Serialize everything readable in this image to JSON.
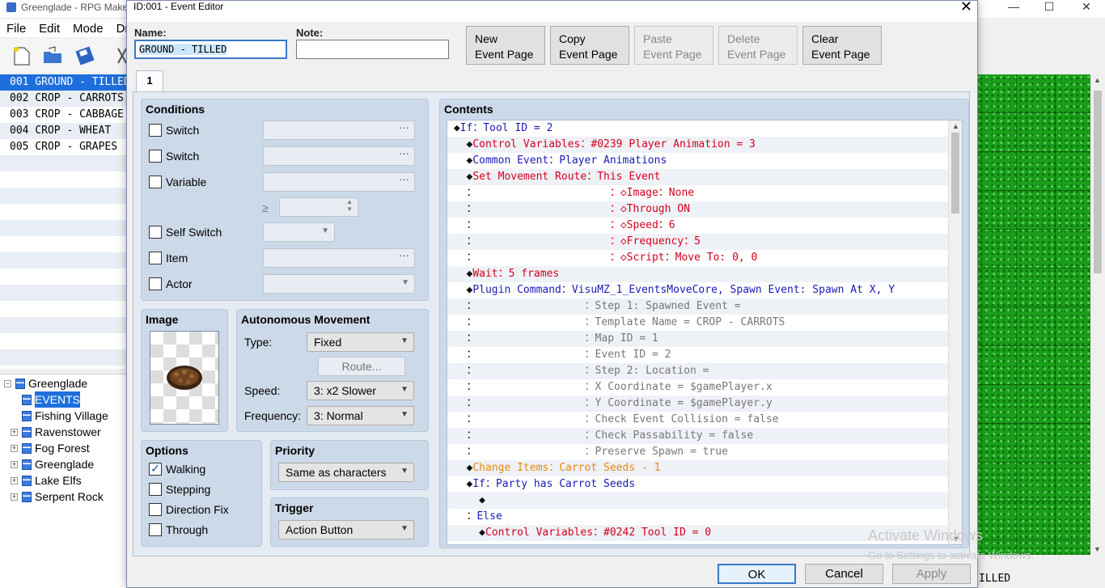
{
  "app": {
    "title": "Greenglade - RPG Maker",
    "menu": [
      "File",
      "Edit",
      "Mode",
      "Dr"
    ],
    "events": [
      {
        "label": "001  GROUND - TILLED",
        "selected": true
      },
      {
        "label": "002  CROP - CARROTS",
        "selected": false
      },
      {
        "label": "003  CROP - CABBAGE",
        "selected": false
      },
      {
        "label": "004  CROP - WHEAT",
        "selected": false
      },
      {
        "label": "005  CROP - GRAPES",
        "selected": false
      }
    ],
    "map_tree": {
      "root": "Greenglade",
      "root_expander": "−",
      "children": [
        {
          "label": "EVENTS",
          "selected": true,
          "expander": ""
        },
        {
          "label": "Fishing Village",
          "selected": false,
          "expander": ""
        },
        {
          "label": "Ravenstower",
          "selected": false,
          "expander": "+"
        },
        {
          "label": "Fog Forest",
          "selected": false,
          "expander": "+"
        },
        {
          "label": "Greenglade",
          "selected": false,
          "expander": "+"
        },
        {
          "label": "Lake Elfs",
          "selected": false,
          "expander": "+"
        },
        {
          "label": "Serpent Rock",
          "selected": false,
          "expander": "+"
        }
      ]
    },
    "status_text": "ILLED",
    "watermark_line1": "Activate Windows",
    "watermark_line2": "Go to Settings to activate Windows."
  },
  "dialog": {
    "title": "ID:001 - Event Editor",
    "name_label": "Name:",
    "name_value": "GROUND - TILLED",
    "note_label": "Note:",
    "note_value": "",
    "buttons": {
      "new_l1": "New",
      "new_l2": "Event Page",
      "copy_l1": "Copy",
      "copy_l2": "Event Page",
      "paste_l1": "Paste",
      "paste_l2": "Event Page",
      "delete_l1": "Delete",
      "delete_l2": "Event Page",
      "clear_l1": "Clear",
      "clear_l2": "Event Page"
    },
    "tab_label": "1",
    "conditions": {
      "title": "Conditions",
      "switch1": "Switch",
      "switch2": "Switch",
      "variable": "Variable",
      "gte": "≥",
      "self_switch": "Self Switch",
      "item": "Item",
      "actor": "Actor",
      "dots": "···"
    },
    "image": {
      "title": "Image"
    },
    "autonomous": {
      "title": "Autonomous Movement",
      "type_label": "Type:",
      "type_value": "Fixed",
      "route_button": "Route...",
      "speed_label": "Speed:",
      "speed_value": "3: x2 Slower",
      "frequency_label": "Frequency:",
      "frequency_value": "3: Normal"
    },
    "options": {
      "title": "Options",
      "walking": "Walking",
      "stepping": "Stepping",
      "direction_fix": "Direction Fix",
      "through": "Through",
      "checked_mark": "✓"
    },
    "priority": {
      "title": "Priority",
      "value": "Same as characters"
    },
    "trigger": {
      "title": "Trigger",
      "value": "Action Button"
    },
    "contents": {
      "title": "Contents",
      "commands": [
        {
          "prefix": " ◆",
          "text": "If：Tool ID = 2",
          "color": "c-blue"
        },
        {
          "prefix": "   ◆",
          "text": "Control Variables：#0239 Player Animation = 3",
          "color": "c-red"
        },
        {
          "prefix": "   ◆",
          "text": "Common Event：Player Animations",
          "color": "c-blue"
        },
        {
          "prefix": "   ◆",
          "text": "Set Movement Route：This Event",
          "color": "c-red"
        },
        {
          "prefix": "   ：                     ",
          "text": "：◇Image：None",
          "color": "c-red"
        },
        {
          "prefix": "   ：                     ",
          "text": "：◇Through ON",
          "color": "c-red"
        },
        {
          "prefix": "   ：                     ",
          "text": "：◇Speed：6",
          "color": "c-red"
        },
        {
          "prefix": "   ：                     ",
          "text": "：◇Frequency：5",
          "color": "c-red"
        },
        {
          "prefix": "   ：                     ",
          "text": "：◇Script：Move To: 0, 0",
          "color": "c-red"
        },
        {
          "prefix": "   ◆",
          "text": "Wait：5 frames",
          "color": "c-red"
        },
        {
          "prefix": "   ◆",
          "text": "Plugin Command：VisuMZ_1_EventsMoveCore, Spawn Event: Spawn At X, Y",
          "color": "c-blue"
        },
        {
          "prefix": "   ：                 ",
          "text": "：Step 1: Spawned Event =",
          "color": "c-gray"
        },
        {
          "prefix": "   ：                 ",
          "text": "：Template Name = CROP - CARROTS",
          "color": "c-gray"
        },
        {
          "prefix": "   ：                 ",
          "text": "：Map ID = 1",
          "color": "c-gray"
        },
        {
          "prefix": "   ：                 ",
          "text": "：Event ID = 2",
          "color": "c-gray"
        },
        {
          "prefix": "   ：                 ",
          "text": "：Step 2: Location =",
          "color": "c-gray"
        },
        {
          "prefix": "   ：                 ",
          "text": "：X Coordinate = $gamePlayer.x",
          "color": "c-gray"
        },
        {
          "prefix": "   ：                 ",
          "text": "：Y Coordinate = $gamePlayer.y",
          "color": "c-gray"
        },
        {
          "prefix": "   ：                 ",
          "text": "：Check Event Collision = false",
          "color": "c-gray"
        },
        {
          "prefix": "   ：                 ",
          "text": "：Check Passability = false",
          "color": "c-gray"
        },
        {
          "prefix": "   ：                 ",
          "text": "：Preserve Spawn = true",
          "color": "c-gray"
        },
        {
          "prefix": "   ◆",
          "text": "Change Items：Carrot Seeds - 1",
          "color": "c-orange"
        },
        {
          "prefix": "   ◆",
          "text": "If：Party has Carrot Seeds",
          "color": "c-blue"
        },
        {
          "prefix": "     ◆",
          "text": "",
          "color": "c-black"
        },
        {
          "prefix": "   ：",
          "text": "Else",
          "color": "c-blue"
        },
        {
          "prefix": "     ◆",
          "text": "Control Variables：#0242 Tool ID = 0",
          "color": "c-red"
        }
      ]
    },
    "footer": {
      "ok": "OK",
      "cancel": "Cancel",
      "apply": "Apply"
    }
  }
}
